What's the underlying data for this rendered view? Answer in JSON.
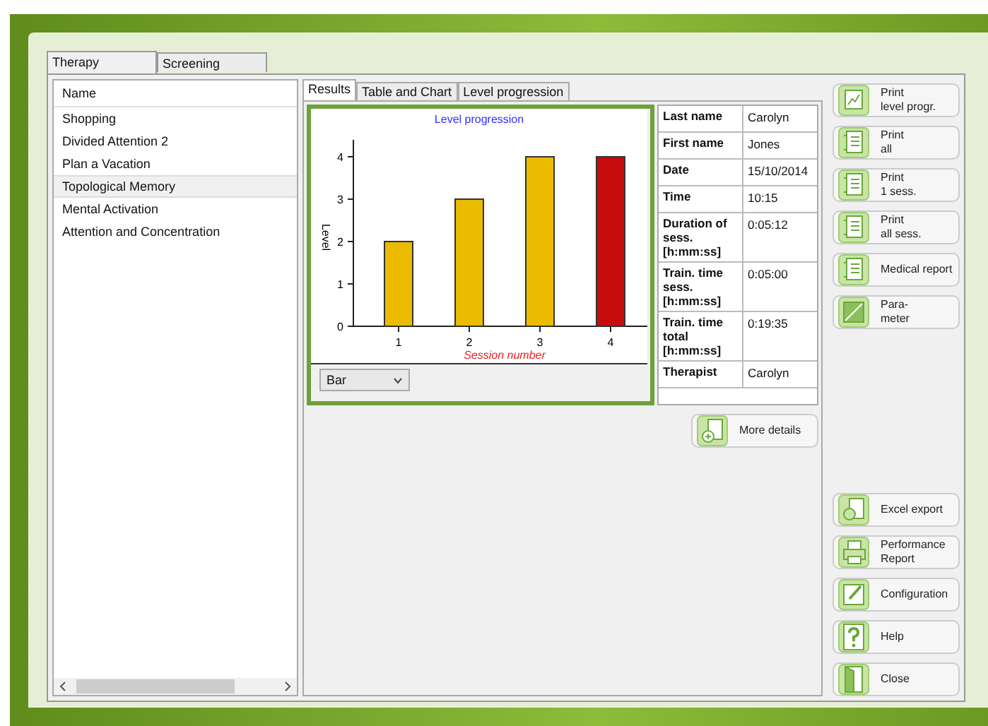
{
  "main_tabs": [
    {
      "label": "Therapy",
      "selected": true
    },
    {
      "label": "Screening",
      "selected": false
    }
  ],
  "exercise_list": {
    "header": "Name",
    "items": [
      {
        "label": "Shopping",
        "selected": false
      },
      {
        "label": "Divided Attention 2",
        "selected": false
      },
      {
        "label": "Plan a Vacation",
        "selected": false
      },
      {
        "label": "Topological Memory",
        "selected": true
      },
      {
        "label": "Mental Activation",
        "selected": false
      },
      {
        "label": "Attention and Concentration",
        "selected": false
      }
    ]
  },
  "result_tabs": [
    {
      "label": "Results",
      "selected": true
    },
    {
      "label": "Table and Chart",
      "selected": false
    },
    {
      "label": "Level progression",
      "selected": false
    }
  ],
  "chart": {
    "chart_data": {
      "type": "bar",
      "title": "Level progression",
      "xlabel": "Session number",
      "ylabel": "Level",
      "categories": [
        "1",
        "2",
        "3",
        "4"
      ],
      "series": [
        {
          "color": "#ebbb00",
          "values": [
            2,
            3,
            4,
            null
          ]
        },
        {
          "color": "#c70c0c",
          "values": [
            null,
            null,
            null,
            4
          ]
        }
      ],
      "ylim": [
        0,
        4.4
      ],
      "yticks": [
        0,
        1,
        2,
        3,
        4
      ]
    },
    "type_dropdown": {
      "value": "Bar"
    }
  },
  "details": [
    {
      "label": "Last name",
      "value": "Carolyn"
    },
    {
      "label": "First name",
      "value": "Jones"
    },
    {
      "label": "Date",
      "value": "15/10/2014"
    },
    {
      "label": "Time",
      "value": "10:15"
    },
    {
      "label": "Duration of sess. [h:mm:ss]",
      "value": "0:05:12"
    },
    {
      "label": "Train. time sess. [h:mm:ss]",
      "value": "0:05:00"
    },
    {
      "label": "Train. time total [h:mm:ss]",
      "value": "0:19:35"
    },
    {
      "label": "Therapist",
      "value": "Carolyn"
    }
  ],
  "more_details_button": "More details",
  "top_buttons": [
    {
      "label": "Print\nlevel progr.",
      "kind": "chart"
    },
    {
      "label": "Print\nall",
      "kind": "doc"
    },
    {
      "label": "Print\n1 sess.",
      "kind": "doc"
    },
    {
      "label": "Print\nall sess.",
      "kind": "doc"
    },
    {
      "label": "Medical report",
      "kind": "doc"
    },
    {
      "label": "Para-\nmeter",
      "kind": "param"
    }
  ],
  "bottom_buttons": [
    {
      "label": "Excel export",
      "kind": "excel"
    },
    {
      "label": "Performance\nReport",
      "kind": "printer"
    },
    {
      "label": "Configuration",
      "kind": "edit"
    },
    {
      "label": "Help",
      "kind": "help"
    },
    {
      "label": "Close",
      "kind": "door"
    }
  ]
}
